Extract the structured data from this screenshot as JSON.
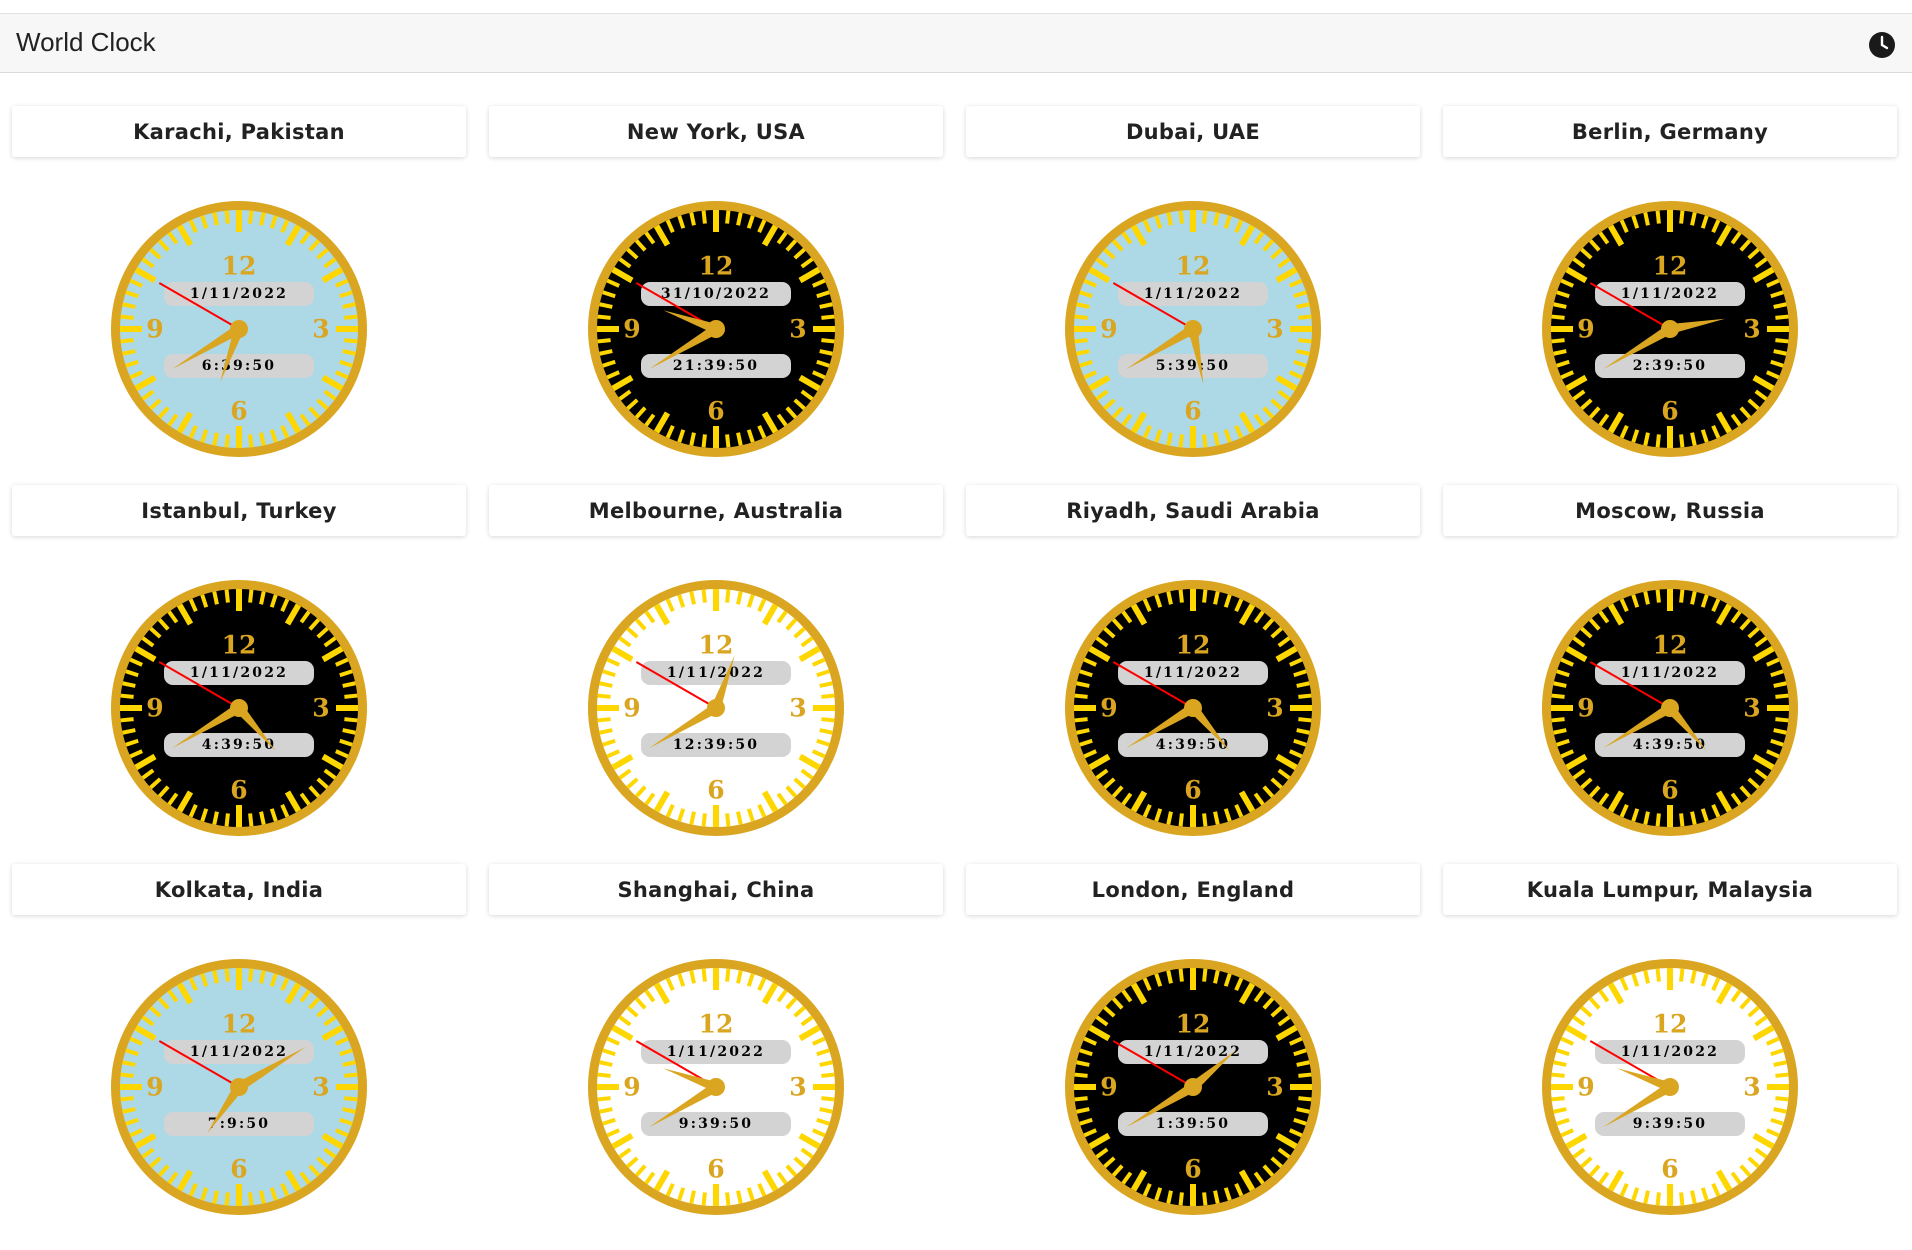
{
  "header": {
    "title": "World Clock",
    "icon": "clock-icon"
  },
  "colors": {
    "rim": "#DAA520",
    "numeral": "#DAA520",
    "tick": "#FFD700",
    "hand": "#DAA520",
    "second_hand": "#FF0000",
    "pill": "#d3d3d3",
    "face_light_blue": "#ADD8E6",
    "face_black": "#000000",
    "face_white": "#FFFFFF"
  },
  "clocks": [
    {
      "city": "Karachi, Pakistan",
      "date": "1/11/2022",
      "time": "6:39:50",
      "face": "lightblue",
      "hours": 6,
      "minutes": 39,
      "seconds": 50
    },
    {
      "city": "New York, USA",
      "date": "31/10/2022",
      "time": "21:39:50",
      "face": "black",
      "hours": 21,
      "minutes": 39,
      "seconds": 50
    },
    {
      "city": "Dubai, UAE",
      "date": "1/11/2022",
      "time": "5:39:50",
      "face": "lightblue",
      "hours": 5,
      "minutes": 39,
      "seconds": 50
    },
    {
      "city": "Berlin, Germany",
      "date": "1/11/2022",
      "time": "2:39:50",
      "face": "black",
      "hours": 2,
      "minutes": 39,
      "seconds": 50
    },
    {
      "city": "Istanbul, Turkey",
      "date": "1/11/2022",
      "time": "4:39:50",
      "face": "black",
      "hours": 4,
      "minutes": 39,
      "seconds": 50
    },
    {
      "city": "Melbourne, Australia",
      "date": "1/11/2022",
      "time": "12:39:50",
      "face": "white",
      "hours": 12,
      "minutes": 39,
      "seconds": 50
    },
    {
      "city": "Riyadh, Saudi Arabia",
      "date": "1/11/2022",
      "time": "4:39:50",
      "face": "black",
      "hours": 4,
      "minutes": 39,
      "seconds": 50
    },
    {
      "city": "Moscow, Russia",
      "date": "1/11/2022",
      "time": "4:39:50",
      "face": "black",
      "hours": 4,
      "minutes": 39,
      "seconds": 50
    },
    {
      "city": "Kolkata, India",
      "date": "1/11/2022",
      "time": "7:9:50",
      "face": "lightblue",
      "hours": 7,
      "minutes": 9,
      "seconds": 50
    },
    {
      "city": "Shanghai, China",
      "date": "1/11/2022",
      "time": "9:39:50",
      "face": "white",
      "hours": 9,
      "minutes": 39,
      "seconds": 50
    },
    {
      "city": "London, England",
      "date": "1/11/2022",
      "time": "1:39:50",
      "face": "black",
      "hours": 1,
      "minutes": 39,
      "seconds": 50
    },
    {
      "city": "Kuala Lumpur, Malaysia",
      "date": "1/11/2022",
      "time": "9:39:50",
      "face": "white",
      "hours": 9,
      "minutes": 39,
      "seconds": 50
    }
  ],
  "numerals": [
    "12",
    "3",
    "6",
    "9"
  ]
}
